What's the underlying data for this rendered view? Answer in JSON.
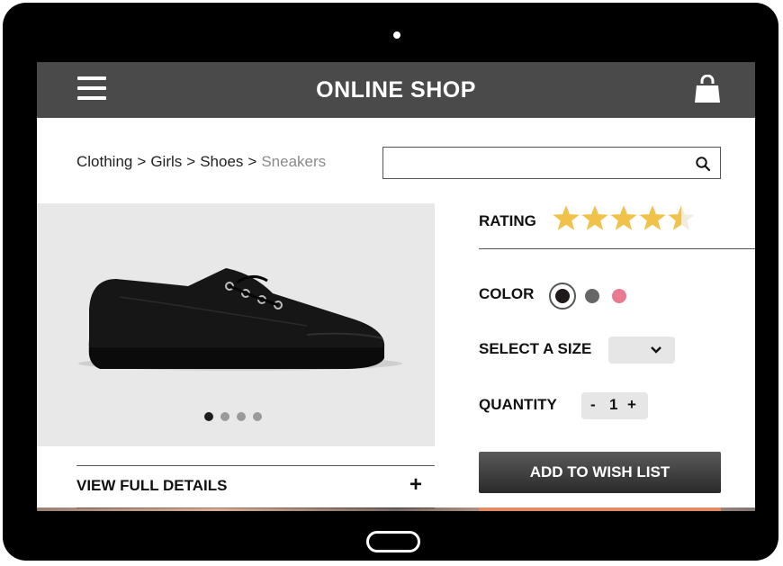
{
  "header": {
    "title": "ONLINE SHOP",
    "menu_icon": "hamburger-menu-icon",
    "cart_icon": "shopping-bag-icon",
    "background_color": "#4a4a4a"
  },
  "breadcrumb": {
    "items": [
      "Clothing",
      "Girls",
      "Shoes"
    ],
    "current": "Sneakers",
    "separator": ">"
  },
  "search": {
    "value": "",
    "placeholder": "",
    "icon": "search-icon"
  },
  "product": {
    "image_description_icon": "black-sneaker-image",
    "carousel": {
      "slide_count": 4,
      "active_index": 0
    },
    "rating_label": "RATING",
    "rating_value": 4.5,
    "rating_max": 5,
    "color_label": "COLOR",
    "colors": [
      {
        "hex": "#1e1a1a",
        "selected": true
      },
      {
        "hex": "#666666",
        "selected": false
      },
      {
        "hex": "#e87a92",
        "selected": false
      }
    ],
    "size_label": "SELECT A SIZE",
    "size_value": "",
    "quantity_label": "QUANTITY",
    "quantity_minus": "-",
    "quantity_value": "1",
    "quantity_plus": "+",
    "details_label": "VIEW FULL DETAILS",
    "details_toggle": "+",
    "wish_list_label": "ADD TO WISH LIST"
  },
  "colors": {
    "star": "#f0c24a",
    "star_empty": "#f1ece0",
    "button_dark": "#3a3a3a"
  }
}
